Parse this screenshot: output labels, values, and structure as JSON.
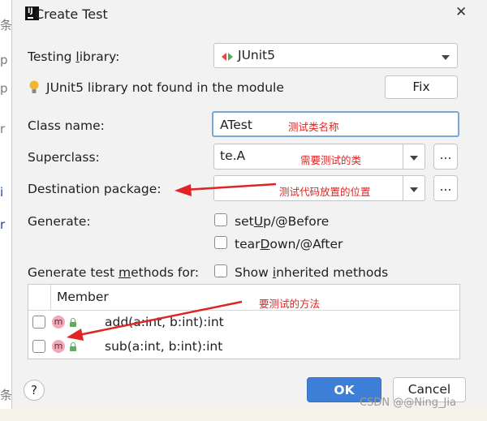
{
  "window": {
    "title": "Create Test",
    "close_glyph": "✕"
  },
  "background_editor": {
    "glyphs": [
      "条",
      "p",
      "p",
      "r",
      "i",
      "r",
      "条"
    ]
  },
  "form": {
    "testing_library_label_pre": "Testing ",
    "testing_library_label_u": "l",
    "testing_library_label_post": "ibrary:",
    "testing_library_value": "JUnit5",
    "warning_text": "JUnit5 library not found in the module",
    "fix_button": "Fix",
    "class_name_label": "Class name:",
    "class_name_value": "ATest",
    "superclass_label": "Superclass:",
    "superclass_value": "te.A",
    "dest_package_label": "Destination package:",
    "dest_package_value": "",
    "browse_button": "...",
    "generate_label": "Generate:",
    "setup_pre": "set",
    "setup_u": "U",
    "setup_post": "p/@Before",
    "teardown_pre": "tear",
    "teardown_u": "D",
    "teardown_post": "own/@After",
    "methods_label_pre": "Generate test ",
    "methods_label_u": "m",
    "methods_label_post": "ethods for:",
    "show_inherited_pre": "Show ",
    "show_inherited_u": "i",
    "show_inherited_post": "nherited methods"
  },
  "table": {
    "header": "Member",
    "rows": [
      {
        "badge": "m",
        "signature": "add(a:int, b:int):int",
        "checked": false
      },
      {
        "badge": "m",
        "signature": "sub(a:int, b:int):int",
        "checked": false
      }
    ]
  },
  "annotations": {
    "class_name_note": "测试类名称",
    "superclass_note": "需要测试的类",
    "package_note": "测试代码放置的位置",
    "methods_note": "要测试的方法"
  },
  "footer": {
    "help": "?",
    "ok": "OK",
    "cancel": "Cancel"
  },
  "watermark": "CSDN @@Ning_Jia",
  "colors": {
    "annotation_red": "#e02424",
    "ok_blue": "#3d7fd6",
    "focus_border": "#7aa7d8"
  }
}
